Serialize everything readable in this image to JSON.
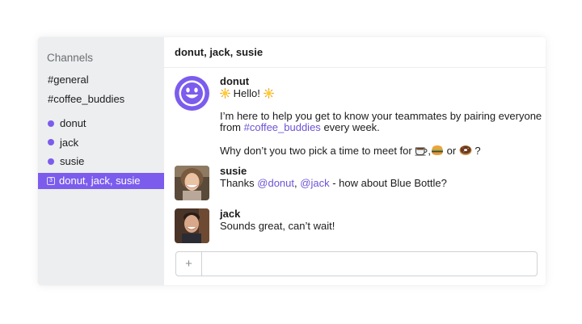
{
  "sidebar": {
    "section_title": "Channels",
    "channels": [
      {
        "label": "#general"
      },
      {
        "label": "#coffee_buddies"
      }
    ],
    "dms": [
      {
        "label": "donut",
        "status_color": "#7c5ced"
      },
      {
        "label": "jack",
        "status_color": "#7c5ced"
      },
      {
        "label": "susie",
        "status_color": "#7c5ced"
      }
    ],
    "active_dm": {
      "badge": "3",
      "label": "donut, jack, susie"
    }
  },
  "header": {
    "title": "donut, jack, susie"
  },
  "messages": [
    {
      "author": "donut",
      "greeting": "Hello!",
      "intro_before": "I’m here to help you get to know your teammates by pairing everyone",
      "intro_from": "from",
      "intro_channel": "#coffee_buddies",
      "intro_after": "every week.",
      "suggest_before": "Why don’t you two pick a time to meet for",
      "suggest_comma": ",",
      "suggest_or": "or",
      "suggest_end": "?"
    },
    {
      "author": "susie",
      "text_before": "Thanks",
      "mention_1": "@donut",
      "sep": ",",
      "mention_2": "@jack",
      "text_after": "- how about Blue Bottle?"
    },
    {
      "author": "jack",
      "text": "Sounds great, can’t wait!"
    }
  ],
  "composer": {
    "plus_label": "+",
    "placeholder": ""
  },
  "colors": {
    "accent": "#7c5ced",
    "mention": "#6d53d6",
    "sidebar_bg": "#eceeef"
  },
  "icons": [
    "sun-icon",
    "coffee-icon",
    "burger-icon",
    "donut-icon",
    "plus-icon"
  ]
}
